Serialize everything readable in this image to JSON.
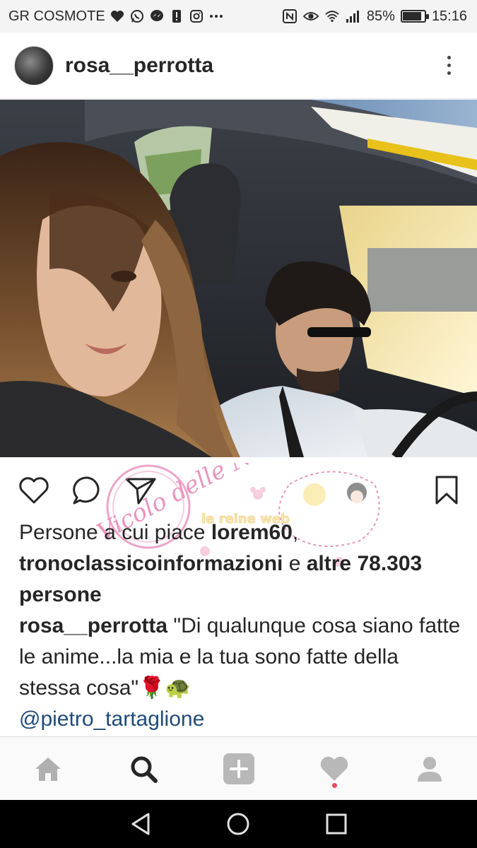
{
  "status_bar": {
    "carrier": "GR COSMOTE",
    "left_icons": [
      "heart-icon",
      "whatsapp-icon",
      "messenger-icon",
      "alert-icon",
      "instagram-icon",
      "more-icon"
    ],
    "right_icons": [
      "nfc-icon",
      "eye-icon",
      "wifi-icon",
      "signal-icon"
    ],
    "battery": "85%",
    "battery_level": 0.85,
    "time": "15:16"
  },
  "post": {
    "username": "rosa__perrotta",
    "likes_prefix": "Persone a cui piace ",
    "liker_1": "lorem60",
    "comma": ",",
    "liker_2": "tronoclassicoinformazioni",
    "and_text": " e ",
    "others": "altre 78.303",
    "persons": "persone",
    "caption_user": "rosa__perrotta",
    "caption_text": " \"Di qualunque cosa siano fatte le anime...la mia e la tua sono fatte della stessa cosa\"",
    "caption_emoji": "🌹🐢",
    "mention": "@pietro_tartaglione"
  },
  "watermark": {
    "left": "Vicolo delle News",
    "right": "le reine web"
  },
  "bottom_nav": [
    "home-icon",
    "search-icon",
    "add-post-icon",
    "activity-icon",
    "profile-icon"
  ],
  "colors": {
    "text": "#262626",
    "mention": "#1f4b7a",
    "notification": "#ed4956",
    "nav_background": "#fafafa"
  }
}
